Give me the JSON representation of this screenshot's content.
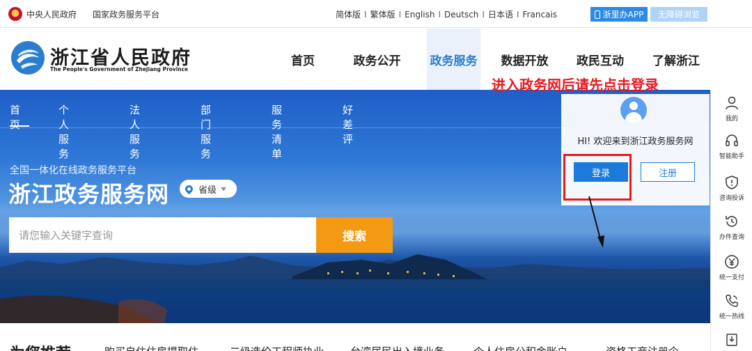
{
  "topbar": {
    "gov_link": "中央人民政府",
    "platform_link": "国家政务服务平台",
    "languages": [
      "简体版",
      "繁体版",
      "English",
      "Deutsch",
      "日本语",
      "Francais"
    ],
    "language_sep": "I",
    "app_button": "浙里办APP",
    "accessibility_button": "无障碍浏览"
  },
  "header": {
    "title": "浙江省人民政府",
    "subtitle": "The People's Government of Zhejiang Province",
    "nav": [
      {
        "label": "首页",
        "active": false
      },
      {
        "label": "政务公开",
        "active": false
      },
      {
        "label": "政务服务",
        "active": true
      },
      {
        "label": "数据开放",
        "active": false
      },
      {
        "label": "政民互动",
        "active": false
      },
      {
        "label": "了解浙江",
        "active": false
      }
    ]
  },
  "subnav": [
    "首页",
    "个人服务",
    "法人服务",
    "部门服务",
    "服务清单",
    "好差评"
  ],
  "hero": {
    "subtitle": "全国一体化在线政务服务平台",
    "title": "浙江政务服务网",
    "level_selector": "省级",
    "search_placeholder": "请您输入关键字查询",
    "search_button": "搜索"
  },
  "login_card": {
    "welcome": "HI! 欢迎来到浙江政务服务网",
    "login_button": "登录",
    "register_button": "注册"
  },
  "annotation": {
    "text": "进入政务网后请先点击登录",
    "color": "#e8181f"
  },
  "sidebar": [
    {
      "label": "我的",
      "icon": "user-icon"
    },
    {
      "label": "智能助手",
      "icon": "headset-icon"
    },
    {
      "label": "咨询投诉",
      "icon": "shield-alert-icon"
    },
    {
      "label": "办件查询",
      "icon": "history-icon"
    },
    {
      "label": "统一支付",
      "icon": "yen-icon"
    },
    {
      "label": "统一热线",
      "icon": "phone-icon"
    },
    {
      "label": "",
      "icon": "download-icon"
    }
  ],
  "bottom": {
    "title": "为您推荐",
    "links": [
      "购买自住住房提取住",
      "二级造价工程师执业",
      "台湾居民出入境业务",
      "个人住房公积金账户",
      "资格工商注册企"
    ]
  },
  "colors": {
    "accent": "#2a7ed0",
    "search_button": "#f39a12",
    "login_button": "#1b7bdc",
    "annotation": "#e8181f"
  }
}
